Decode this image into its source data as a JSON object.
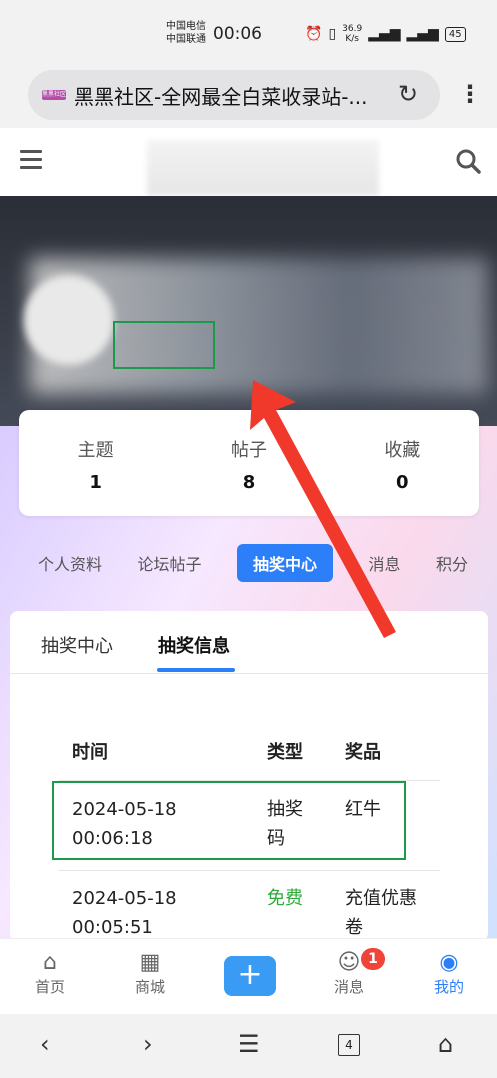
{
  "status": {
    "carrier1": "中国电信",
    "carrier2": "中国联通",
    "time": "00:06",
    "net_speed_value": "36.9",
    "net_speed_unit": "K/s",
    "battery": "45"
  },
  "browser": {
    "favicon_text": "黑黑社区",
    "title": "黑黑社区-全网最全白菜收录站-..."
  },
  "stats": [
    {
      "label": "主题",
      "value": "1"
    },
    {
      "label": "帖子",
      "value": "8"
    },
    {
      "label": "收藏",
      "value": "0"
    }
  ],
  "profile_tabs": [
    "个人资料",
    "论坛帖子",
    "抽奖中心",
    "消息",
    "积分"
  ],
  "sub_tabs": [
    "抽奖中心",
    "抽奖信息"
  ],
  "table": {
    "headers": [
      "时间",
      "类型",
      "奖品"
    ],
    "rows": [
      {
        "date": "2024-05-18",
        "time": "00:06:18",
        "type_line1": "抽奖",
        "type_line2": "码",
        "prize_line1": "红牛",
        "prize_line2": ""
      },
      {
        "date": "2024-05-18",
        "time": "00:05:51",
        "type_line1": "免费",
        "type_line2": "",
        "prize_line1": "充值优惠",
        "prize_line2": "卷"
      }
    ]
  },
  "bottom_nav": [
    {
      "label": "首页",
      "icon": "home-icon"
    },
    {
      "label": "商城",
      "icon": "grid-icon"
    },
    {
      "label": "",
      "icon": "plus-icon"
    },
    {
      "label": "消息",
      "icon": "message-icon"
    },
    {
      "label": "我的",
      "icon": "user-icon"
    }
  ],
  "message_badge": "1",
  "system_nav": {
    "tab_count": "4"
  },
  "colors": {
    "accent": "#2d7ff9",
    "highlight_box": "#1a9a4a",
    "free_text": "#2eaa3a",
    "badge": "#f0443a",
    "arrow": "#f0392b"
  }
}
